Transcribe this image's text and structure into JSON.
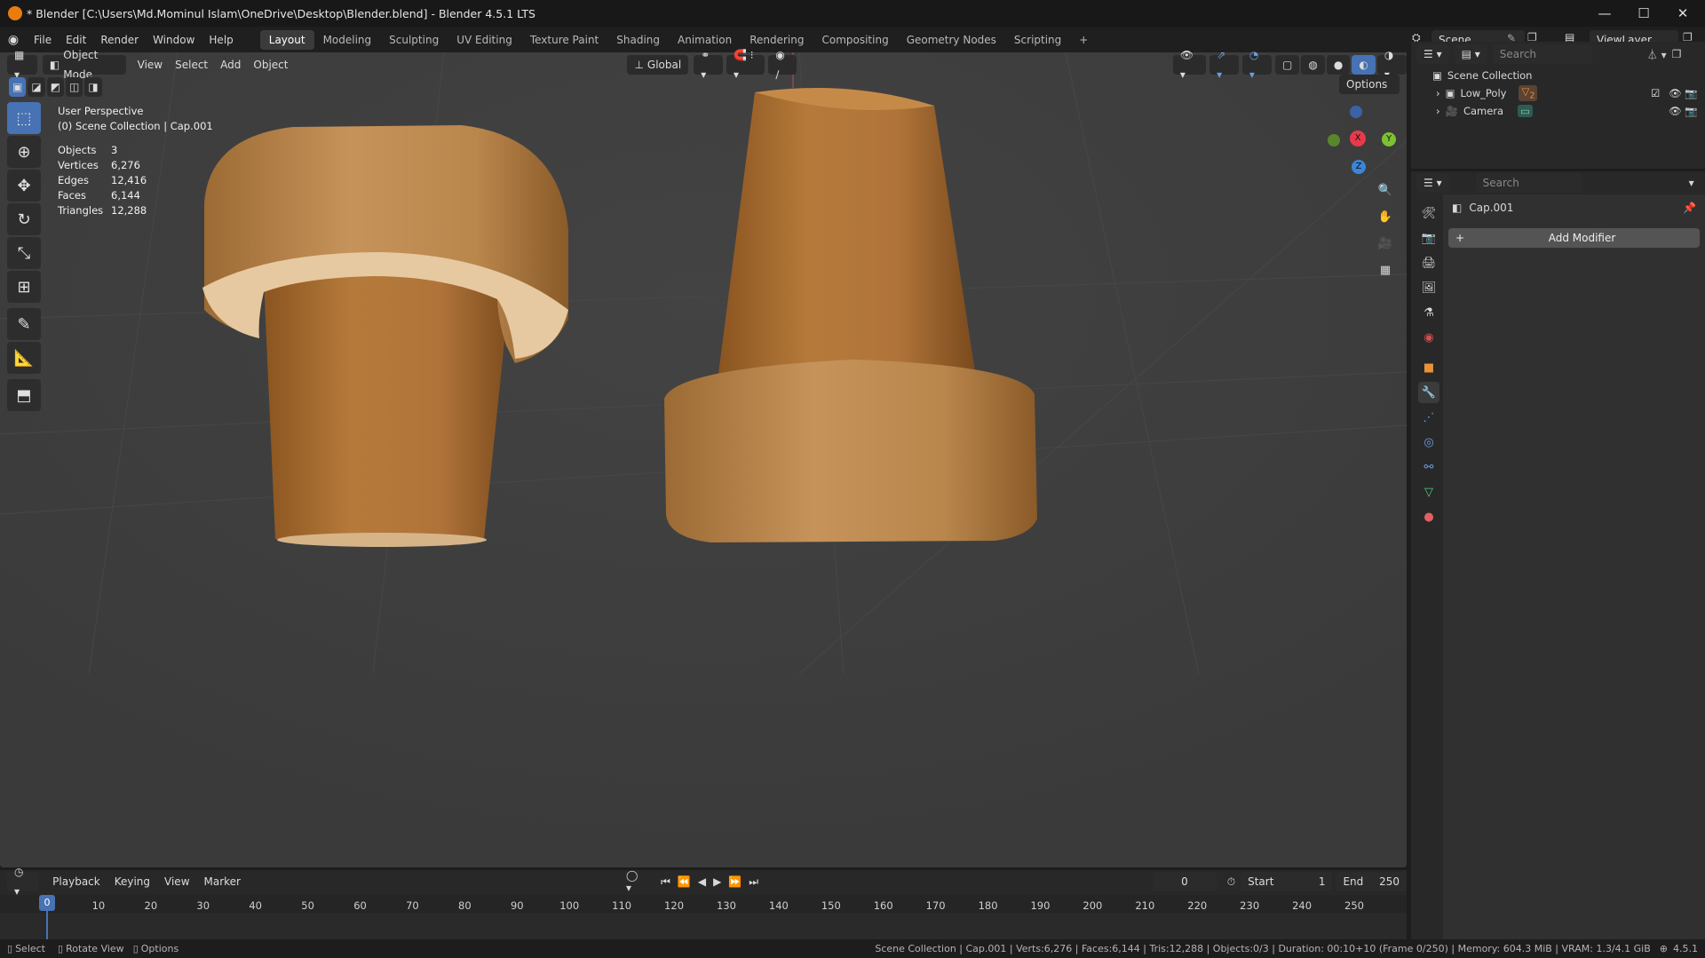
{
  "window": {
    "title": "* Blender [C:\\Users\\Md.Mominul Islam\\OneDrive\\Desktop\\Blender.blend] - Blender 4.5.1 LTS",
    "minimize": "—",
    "maximize": "☐",
    "close": "✕"
  },
  "menus": [
    "File",
    "Edit",
    "Render",
    "Window",
    "Help"
  ],
  "workspaces": [
    "Layout",
    "Modeling",
    "Sculpting",
    "UV Editing",
    "Texture Paint",
    "Shading",
    "Animation",
    "Rendering",
    "Compositing",
    "Geometry Nodes",
    "Scripting"
  ],
  "active_workspace": "Layout",
  "add_workspace": "+",
  "scene": {
    "name": "Scene",
    "view_layer": "ViewLayer"
  },
  "viewport": {
    "mode": "Object Mode",
    "menus": [
      "View",
      "Select",
      "Add",
      "Object"
    ],
    "transform_orientation": "Global",
    "options_label": "Options",
    "overlay_title": "User Perspective",
    "overlay_subtitle": "(0) Scene Collection | Cap.001",
    "stats": [
      {
        "label": "Objects",
        "value": "3"
      },
      {
        "label": "Vertices",
        "value": "6,276"
      },
      {
        "label": "Edges",
        "value": "12,416"
      },
      {
        "label": "Faces",
        "value": "6,144"
      },
      {
        "label": "Triangles",
        "value": "12,288"
      }
    ],
    "gizmo": {
      "x": "X",
      "y": "Y",
      "z": "Z"
    },
    "colors": {
      "background": "#3d3d3d",
      "cork": "#b57a3a",
      "cork_top": "#c99a5c",
      "x_axis": "#e8394c",
      "y_axis": "#7cc233",
      "z_axis": "#3a85db",
      "active_tool": "#4772b3"
    }
  },
  "tools": [
    "select-box-icon",
    "cursor-icon",
    "move-icon",
    "rotate-icon",
    "scale-icon",
    "transform-icon",
    "annotate-icon",
    "measure-icon",
    "add-cube-icon"
  ],
  "outliner": {
    "search_placeholder": "Search",
    "root": "Scene Collection",
    "items": [
      {
        "name": "Low_Poly",
        "badge": "2"
      },
      {
        "name": "Camera"
      }
    ]
  },
  "properties": {
    "search_placeholder": "Search",
    "object_name": "Cap.001",
    "add_modifier": "Add Modifier",
    "add_modifier_plus": "+"
  },
  "timeline": {
    "menus": [
      "Playback",
      "Keying",
      "View",
      "Marker"
    ],
    "current_frame": "0",
    "start_label": "Start",
    "start": "1",
    "end_label": "End",
    "end": "250",
    "ticks": [
      "0",
      "10",
      "20",
      "30",
      "40",
      "50",
      "60",
      "70",
      "80",
      "90",
      "100",
      "110",
      "120",
      "130",
      "140",
      "150",
      "160",
      "170",
      "180",
      "190",
      "200",
      "210",
      "220",
      "230",
      "240",
      "250"
    ]
  },
  "statusbar": {
    "select": "Select",
    "rotate": "Rotate View",
    "options": "Options",
    "info": "Scene Collection | Cap.001 | Verts:6,276 | Faces:6,144 | Tris:12,288 | Objects:0/3 | Duration: 00:10+10 (Frame 0/250) | Memory: 604.3 MiB | VRAM: 1.3/4.1 GiB",
    "version": "4.5.1"
  }
}
